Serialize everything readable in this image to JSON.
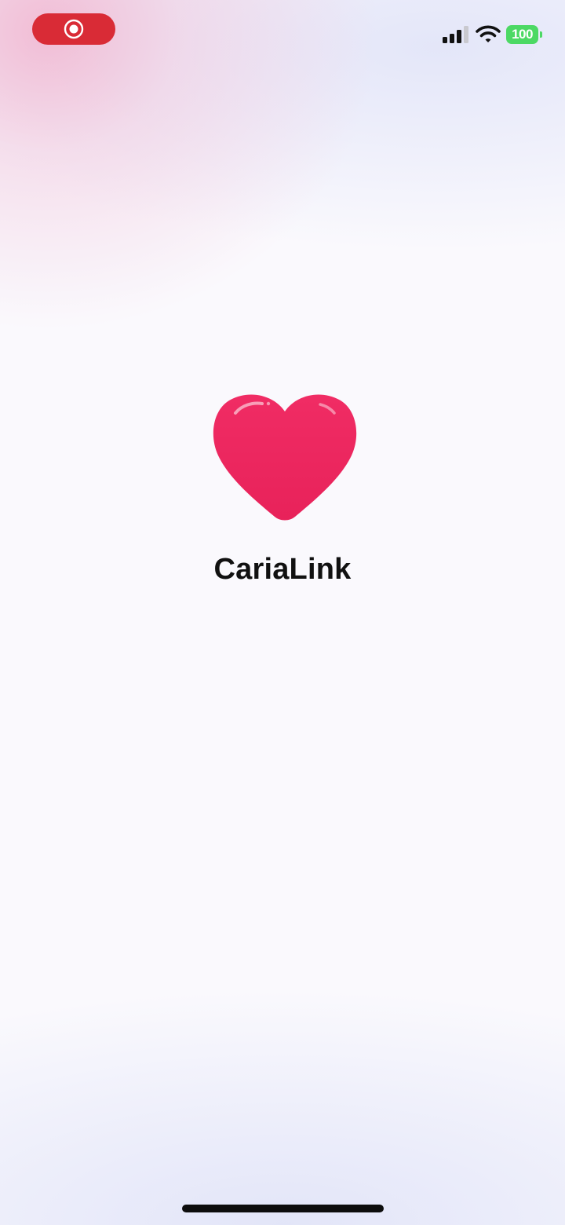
{
  "status_bar": {
    "recording_indicator": {
      "icon": "record-icon",
      "color": "#d92b36"
    },
    "signal_icon": "cellular-signal-icon",
    "wifi_icon": "wifi-icon",
    "battery": {
      "level": "100",
      "color": "#4cd964"
    }
  },
  "splash": {
    "logo_icon": "heart-icon",
    "logo_color": "#ef2561",
    "app_name": "CariaLink"
  },
  "home_indicator": {
    "color": "#0d0d0d"
  }
}
